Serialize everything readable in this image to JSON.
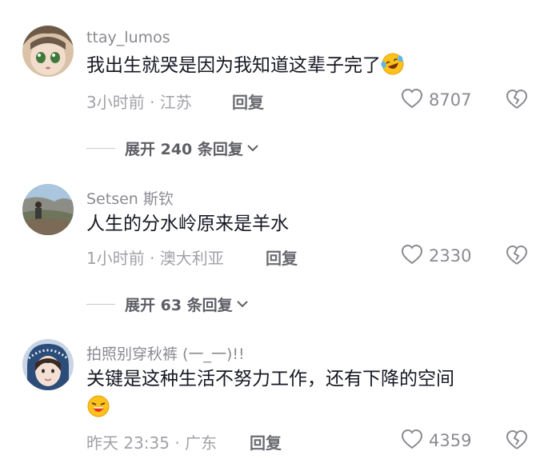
{
  "comments": [
    {
      "username": "ttay_lumos",
      "text": "我出生就哭是因为我知道这辈子完了",
      "time_location": "3小时前 · 江苏",
      "reply_label": "回复",
      "likes": "8707",
      "emoji_icon": "laughing-tears-emoji-icon",
      "expand_label": "展开 240 条回复"
    },
    {
      "username": "Setsen 斯钦",
      "text": "人生的分水岭原来是羊水",
      "time_location": "1小时前 · 澳大利亚",
      "reply_label": "回复",
      "likes": "2330",
      "expand_label": "展开 63 条回复"
    },
    {
      "username": "拍照别穿秋裤 (一_一)!!",
      "text": "关键是这种生活不努力工作，还有下降的空间",
      "time_location": "昨天 23:35 · 广东",
      "reply_label": "回复",
      "likes": "4359",
      "emoji_icon": "crying-laughing-emoji-icon"
    }
  ],
  "colors": {
    "primary_text": "#161823",
    "secondary_text": "#8a8b91",
    "meta_text": "#a1a2a7"
  }
}
